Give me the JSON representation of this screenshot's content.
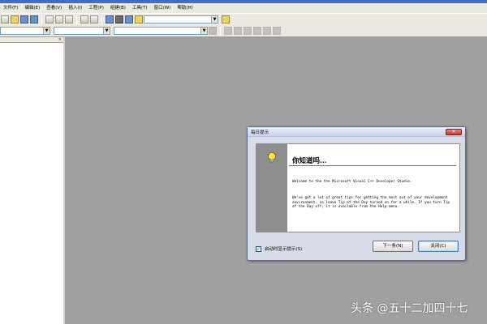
{
  "menubar": {
    "items": [
      "文件(F)",
      "编辑(E)",
      "查看(V)",
      "插入(I)",
      "工程(P)",
      "组建(B)",
      "工具(T)",
      "窗口(W)",
      "帮助(H)"
    ]
  },
  "toolbar": {
    "icons": [
      "new-icon",
      "open-icon",
      "save-icon",
      "save-all-icon",
      "cut-icon",
      "copy-icon",
      "paste-icon",
      "undo-icon",
      "redo-icon",
      "workspace-icon",
      "output-icon",
      "window-list-icon",
      "find-in-files-icon",
      "search-combo",
      "find-icon"
    ]
  },
  "dialog": {
    "title": "每日提示",
    "heading": "你知道吗…",
    "paragraph1": "Welcome to the the Microsoft Visual C++ Developer Studio.",
    "paragraph2": "We've got a lot of great tips for getting the most out of your development environment, so leave Tip of the Day turned on for a while. If you turn Tip of the Day off, it is available from the Help menu.",
    "checkbox_label": "启动时显示提示(S)",
    "checkbox_checked": true,
    "next_button": "下一条(N)",
    "close_button": "关闭(C)"
  },
  "watermark": "头条 @五十二加四十七",
  "colors": {
    "app_background": "#a0a0a0",
    "toolbar_background": "#ece9e1",
    "dialog_side": "#8e8e8e"
  }
}
